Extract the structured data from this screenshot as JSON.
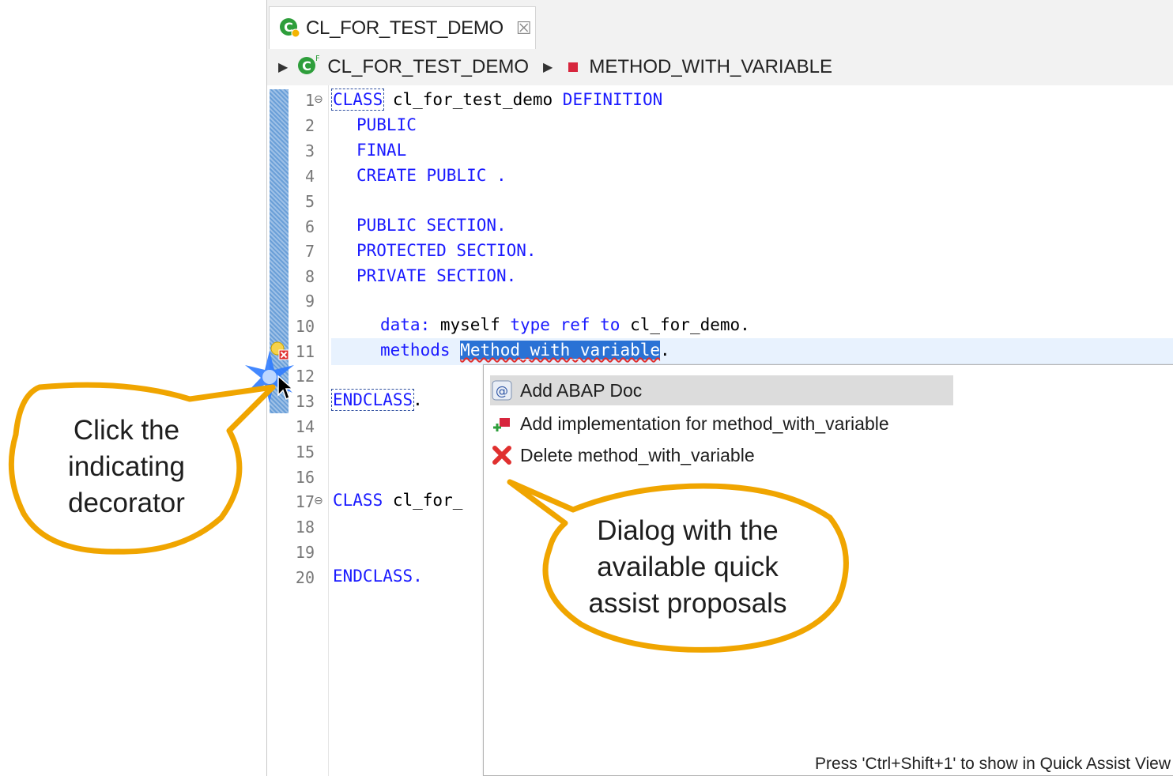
{
  "editor": {
    "tab_title": "CL_FOR_TEST_DEMO",
    "tab_close_glyph": "☒",
    "breadcrumb": {
      "class_name": "CL_FOR_TEST_DEMO",
      "method_name": "METHOD_WITH_VARIABLE"
    },
    "line_numbers": [
      "1",
      "2",
      "3",
      "4",
      "5",
      "6",
      "7",
      "8",
      "9",
      "10",
      "11",
      "12",
      "13",
      "14",
      "15",
      "16",
      "17",
      "18",
      "19",
      "20"
    ],
    "fold_markers": [
      "⊖",
      "⊖"
    ],
    "code": {
      "l1_kw": "CLASS",
      "l1_name": " cl_for_test_demo ",
      "l1_kw2": "DEFINITION",
      "l2": "PUBLIC",
      "l3": "FINAL",
      "l4": "CREATE PUBLIC .",
      "l6": "PUBLIC SECTION.",
      "l7": "PROTECTED SECTION.",
      "l8": "PRIVATE SECTION.",
      "l10_kw": "data:",
      "l10_a": " myself ",
      "l10_kw2": "type ref to",
      "l10_b": " cl_for_demo.",
      "l11_kw": "methods",
      "l11_sel": "Method_with_variable",
      "l11_end": ".",
      "l13": "ENDCLASS",
      "l13_end": ".",
      "l17_kw": "CLASS",
      "l17_name": " cl_for_",
      "l20": "ENDCLASS."
    }
  },
  "quick_assist": {
    "items": [
      {
        "label": "Add ABAP Doc",
        "icon": "abap-doc-icon"
      },
      {
        "label": "Add implementation for method_with_variable",
        "icon": "add-implementation-icon"
      },
      {
        "label": "Delete method_with_variable",
        "icon": "delete-icon"
      }
    ],
    "hint": "Press 'Ctrl+Shift+1' to show in Quick Assist View"
  },
  "callouts": {
    "left": [
      "Click the",
      "indicating",
      "decorator"
    ],
    "right": [
      "Dialog with the",
      "available quick",
      "assist proposals"
    ]
  },
  "colors": {
    "keyword": "#1a1aff",
    "selection": "#2a72d5",
    "callout_border": "#f0a500",
    "gutter_bar": "#6a9fd8"
  }
}
